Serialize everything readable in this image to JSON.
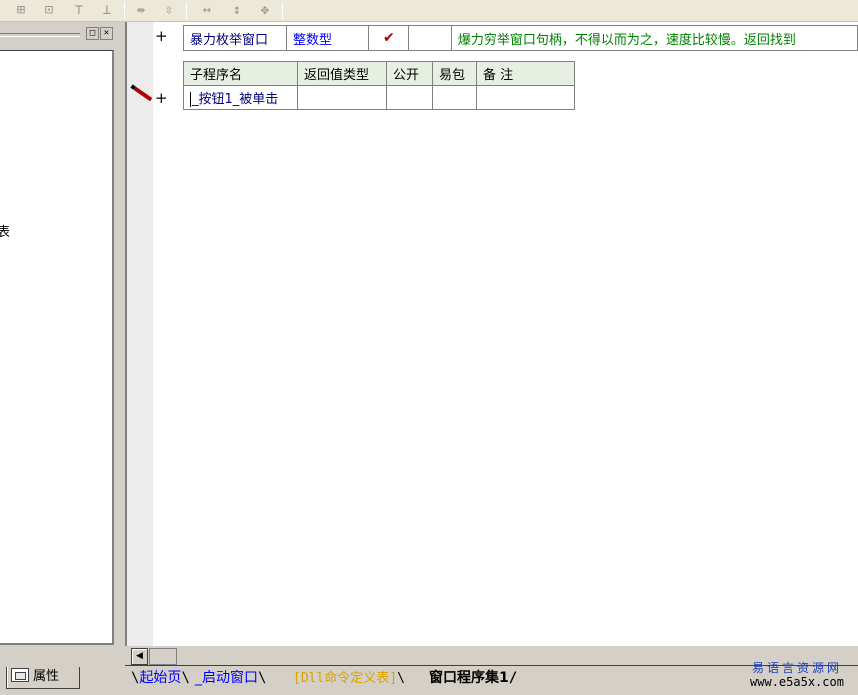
{
  "left_panel": {
    "cut_text": "表",
    "properties_tab_label": "属性"
  },
  "code_editor": {
    "variable_row": {
      "name": "暴力枚举窗口",
      "type": "整数型",
      "checked": "✔",
      "note": "爆力穷举窗口句柄，不得以而为之，速度比较慢。返回找到"
    },
    "subroutine_table": {
      "headers": [
        "子程序名",
        "返回值类型",
        "公开",
        "易包",
        "备 注"
      ],
      "row": {
        "name": "_按钮1_被单击",
        "return_type": "",
        "public": "",
        "easy_pkg": "",
        "note": ""
      }
    }
  },
  "sheet_tabs": [
    {
      "label": "起始页",
      "active": false
    },
    {
      "label": "_启动窗口",
      "active": false
    },
    {
      "label": "[Dll命令定义表]",
      "active": false
    },
    {
      "label": "窗口程序集1",
      "active": true
    }
  ],
  "watermark": {
    "name": "易语言资源网",
    "url": "www.e5a5x.com"
  },
  "colors": {
    "note_green": "#008000",
    "type_blue": "#0000ff",
    "header_bg": "#e7efe2",
    "dll_tab": "#d9a400"
  }
}
